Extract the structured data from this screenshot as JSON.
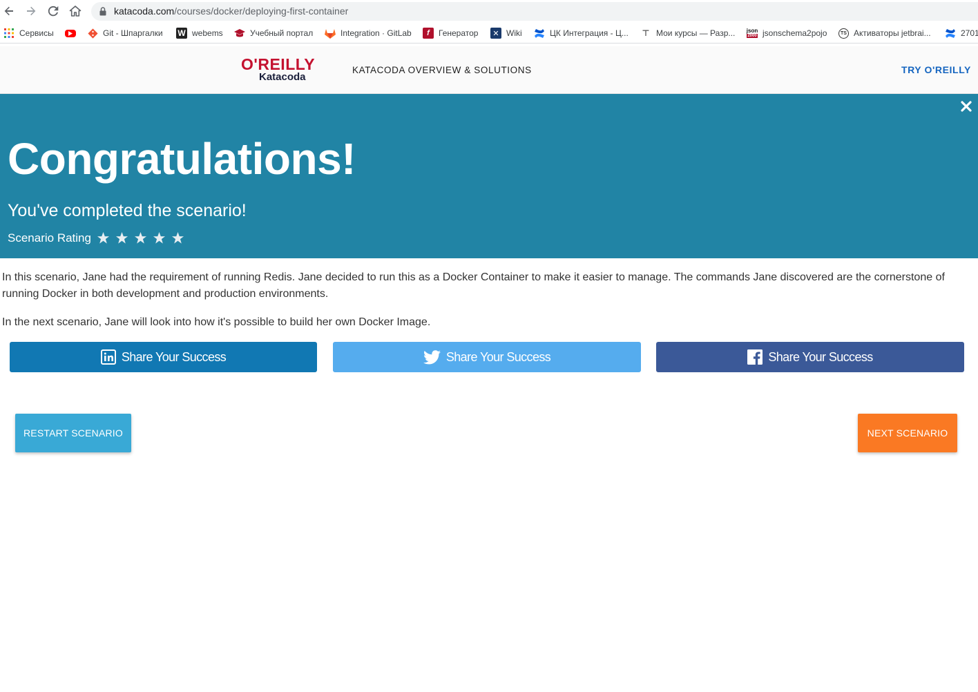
{
  "browser": {
    "url_domain": "katacoda.com",
    "url_path": "/courses/docker/deploying-first-container",
    "bookmarks": [
      {
        "label": "Сервисы",
        "icon": "apps-grid-icon"
      },
      {
        "label": "",
        "icon": "youtube-icon"
      },
      {
        "label": "Git - Шпаргалки",
        "icon": "git-icon"
      },
      {
        "label": "webems",
        "icon": "w-icon"
      },
      {
        "label": "Учебный портал",
        "icon": "graduation-cap-icon"
      },
      {
        "label": "Integration · GitLab",
        "icon": "gitlab-icon"
      },
      {
        "label": "Генератор",
        "icon": "generator-icon"
      },
      {
        "label": "Wiki",
        "icon": "wiki-icon"
      },
      {
        "label": "ЦК Интеграция - Ц...",
        "icon": "confluence-icon"
      },
      {
        "label": "Мои курсы — Разр...",
        "icon": "course-icon"
      },
      {
        "label": "jsonschema2pojo",
        "icon": "json-icon"
      },
      {
        "label": "Активаторы jetbrai...",
        "icon": "ts-icon"
      },
      {
        "label": "2701",
        "icon": "confluence-icon"
      }
    ]
  },
  "header": {
    "logo_top": "O'REILLY",
    "logo_bottom": "Katacoda",
    "nav_label": "KATACODA OVERVIEW & SOLUTIONS",
    "cta_label": "TRY O'REILLY"
  },
  "banner": {
    "title": "Congratulations!",
    "subtitle": "You've completed the scenario!",
    "rating_label": "Scenario Rating",
    "rating_stars": 5
  },
  "body": {
    "paragraph1": "In this scenario, Jane had the requirement of running Redis. Jane decided to run this as a Docker Container to make it easier to manage. The commands Jane discovered are the cornerstone of running Docker in both development and production environments.",
    "paragraph2": "In the next scenario, Jane will look into how it's possible to build her own Docker Image."
  },
  "share": {
    "linkedin_label": "Share Your Success",
    "twitter_label": "Share Your Success",
    "facebook_label": "Share Your Success"
  },
  "actions": {
    "restart_label": "RESTART SCENARIO",
    "next_label": "NEXT SCENARIO"
  },
  "colors": {
    "banner": "#2184a5",
    "linkedin": "#1178b3",
    "twitter": "#55acee",
    "facebook": "#3b5998",
    "restart": "#39a9d6",
    "next": "#fa7923",
    "oreilly_red": "#c41230"
  }
}
